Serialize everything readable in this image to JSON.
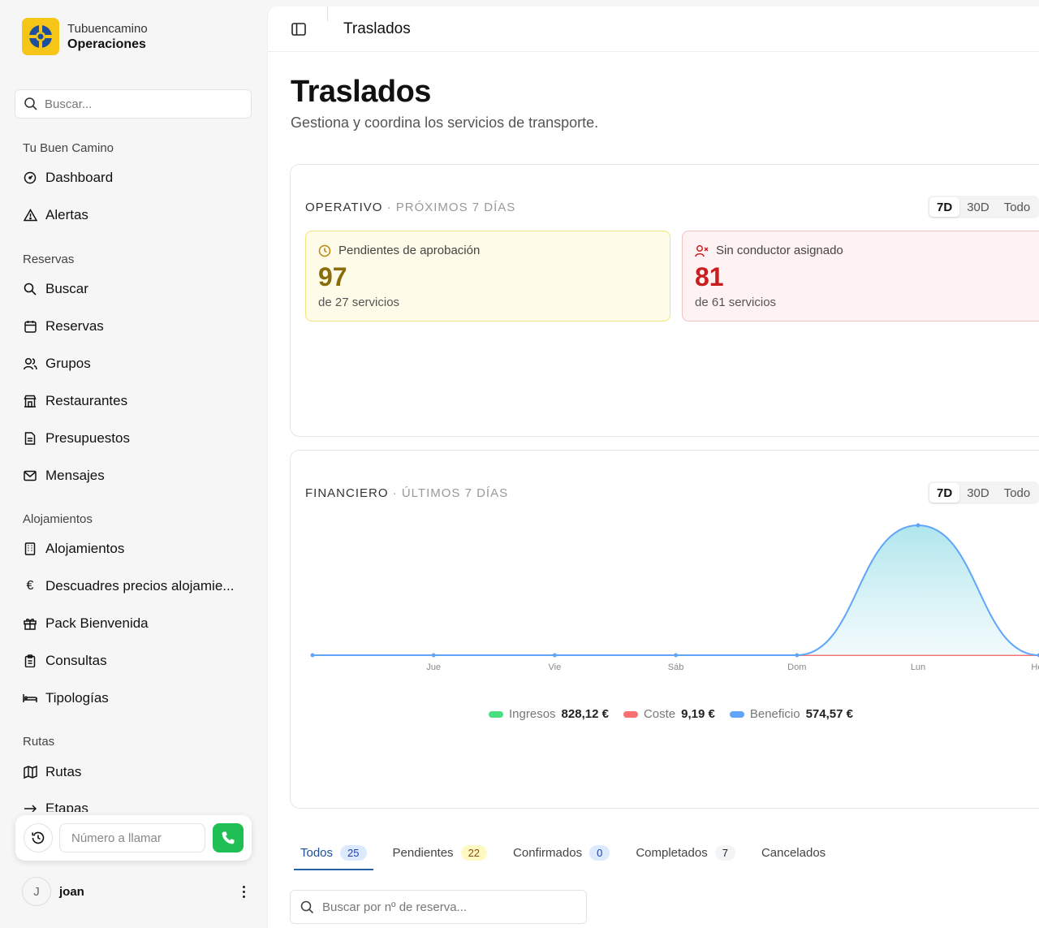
{
  "brand": {
    "sub": "Tubuencamino",
    "main": "Operaciones"
  },
  "sidebar": {
    "search_placeholder": "Buscar...",
    "sections": [
      {
        "title": "Tu Buen Camino",
        "items": [
          {
            "label": "Dashboard",
            "icon": "gauge-icon"
          },
          {
            "label": "Alertas",
            "icon": "alert-triangle-icon"
          }
        ]
      },
      {
        "title": "Reservas",
        "items": [
          {
            "label": "Buscar",
            "icon": "search-icon"
          },
          {
            "label": "Reservas",
            "icon": "calendar-icon"
          },
          {
            "label": "Grupos",
            "icon": "users-icon"
          },
          {
            "label": "Restaurantes",
            "icon": "store-icon"
          },
          {
            "label": "Presupuestos",
            "icon": "file-icon"
          },
          {
            "label": "Mensajes",
            "icon": "mail-icon"
          }
        ]
      },
      {
        "title": "Alojamientos",
        "items": [
          {
            "label": "Alojamientos",
            "icon": "building-icon"
          },
          {
            "label": "Descuadres precios alojamie...",
            "icon": "euro-icon"
          },
          {
            "label": "Pack Bienvenida",
            "icon": "gift-icon"
          },
          {
            "label": "Consultas",
            "icon": "clipboard-icon"
          },
          {
            "label": "Tipologías",
            "icon": "bed-icon"
          }
        ]
      },
      {
        "title": "Rutas",
        "items": [
          {
            "label": "Rutas",
            "icon": "map-icon"
          },
          {
            "label": "Etapas",
            "icon": "arrow-right-icon"
          }
        ]
      }
    ],
    "call_placeholder": "Número a llamar",
    "user": {
      "initial": "J",
      "name": "joan"
    }
  },
  "topbar": {
    "title": "Traslados"
  },
  "page": {
    "title": "Traslados",
    "subtitle": "Gestiona y coordina los servicios de transporte."
  },
  "operativo": {
    "title": "OPERATIVO",
    "period": "· PRÓXIMOS 7 DÍAS",
    "ranges": [
      "7D",
      "30D",
      "Todo"
    ],
    "pending": {
      "label": "Pendientes de aprobación",
      "value": "97",
      "foot": "de 27 servicios"
    },
    "no_driver": {
      "label": "Sin conductor asignado",
      "value": "81",
      "foot": "de 61 servicios"
    }
  },
  "financiero": {
    "title": "FINANCIERO",
    "period": "· ÚLTIMOS 7 DÍAS",
    "ranges": [
      "7D",
      "30D",
      "Todo"
    ],
    "legend": [
      {
        "label": "Ingresos",
        "value": "828,12 €",
        "color": "#4ade80"
      },
      {
        "label": "Coste",
        "value": "9,19 €",
        "color": "#f87171"
      },
      {
        "label": "Beneficio",
        "value": "574,57 €",
        "color": "#60a5fa"
      }
    ]
  },
  "chart_data": {
    "type": "area",
    "categories": [
      "",
      "Jue",
      "Vie",
      "Sáb",
      "Dom",
      "Lun",
      "Hoy"
    ],
    "series": [
      {
        "name": "Beneficio",
        "values": [
          0,
          0,
          0,
          0,
          0,
          574.57,
          0
        ],
        "color": "#60a5fa"
      },
      {
        "name": "Coste",
        "values": [
          0,
          0,
          0,
          0,
          0,
          0,
          0
        ],
        "color": "#f87171"
      }
    ],
    "grid": false
  },
  "tabs": [
    {
      "label": "Todos",
      "count": "25",
      "active": true,
      "badge_bg": "#dbeafe",
      "badge_fg": "#1e40af"
    },
    {
      "label": "Pendientes",
      "count": "22",
      "badge_bg": "#fef9c3",
      "badge_fg": "#854d0e"
    },
    {
      "label": "Confirmados",
      "count": "0",
      "badge_bg": "#dbeafe",
      "badge_fg": "#1e40af"
    },
    {
      "label": "Completados",
      "count": "7",
      "badge_bg": "#f3f4f6",
      "badge_fg": "#222222"
    },
    {
      "label": "Cancelados",
      "count": ""
    }
  ],
  "reservation_search_placeholder": "Buscar por nº de reserva..."
}
